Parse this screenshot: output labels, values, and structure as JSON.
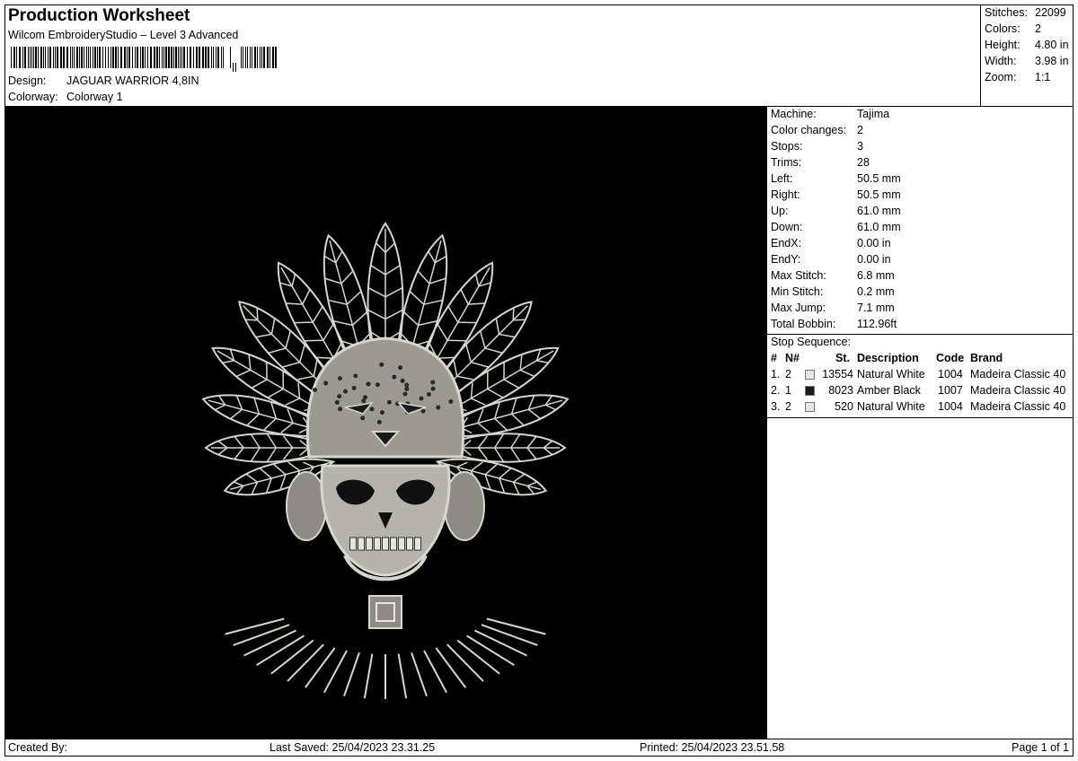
{
  "header": {
    "title": "Production Worksheet",
    "subtitle": "Wilcom EmbroideryStudio – Level 3 Advanced",
    "design_label": "Design:",
    "design_value": "JAGUAR WARRIOR 4,8IN",
    "colorway_label": "Colorway:",
    "colorway_value": "Colorway 1"
  },
  "stats": [
    {
      "label": "Stitches:",
      "value": "22099"
    },
    {
      "label": "Colors:",
      "value": "2"
    },
    {
      "label": "Height:",
      "value": "4.80 in"
    },
    {
      "label": "Width:",
      "value": "3.98 in"
    },
    {
      "label": "Zoom:",
      "value": "1:1"
    }
  ],
  "machine_info": [
    {
      "label": "Machine:",
      "value": "Tajima"
    },
    {
      "label": "Color changes:",
      "value": "2"
    },
    {
      "label": "Stops:",
      "value": "3"
    },
    {
      "label": "Trims:",
      "value": "28"
    },
    {
      "label": "Left:",
      "value": "50.5 mm"
    },
    {
      "label": "Right:",
      "value": "50.5 mm"
    },
    {
      "label": "Up:",
      "value": "61.0 mm"
    },
    {
      "label": "Down:",
      "value": "61.0 mm"
    },
    {
      "label": "EndX:",
      "value": "0.00 in"
    },
    {
      "label": "EndY:",
      "value": "0.00 in"
    },
    {
      "label": "Max Stitch:",
      "value": "6.8 mm"
    },
    {
      "label": "Min Stitch:",
      "value": "0.2 mm"
    },
    {
      "label": "Max Jump:",
      "value": "7.1 mm"
    },
    {
      "label": "Total Bobbin:",
      "value": "112.96ft"
    }
  ],
  "stop_sequence": {
    "title": "Stop Sequence:",
    "headers": {
      "num": "#",
      "n": "N#",
      "st": "St.",
      "description": "Description",
      "code": "Code",
      "brand": "Brand"
    },
    "rows": [
      {
        "num": "1.",
        "n": "2",
        "color": "#e4e4e4",
        "st": "13554",
        "description": "Natural White",
        "code": "1004",
        "brand": "Madeira Classic 40"
      },
      {
        "num": "2.",
        "n": "1",
        "color": "#1a1a1a",
        "st": "8023",
        "description": "Amber Black",
        "code": "1007",
        "brand": "Madeira Classic 40"
      },
      {
        "num": "3.",
        "n": "2",
        "color": "#e4e4e4",
        "st": "520",
        "description": "Natural White",
        "code": "1004",
        "brand": "Madeira Classic 40"
      }
    ]
  },
  "footer": {
    "created_by": "Created By:",
    "last_saved": "Last Saved: 25/04/2023 23.31.25",
    "printed": "Printed: 25/04/2023 23.51.58",
    "page": "Page 1 of 1"
  },
  "preview": {
    "background": "#000000",
    "thread_color": "#d6d6cc",
    "icon": "jaguar-skull-warrior-icon"
  }
}
